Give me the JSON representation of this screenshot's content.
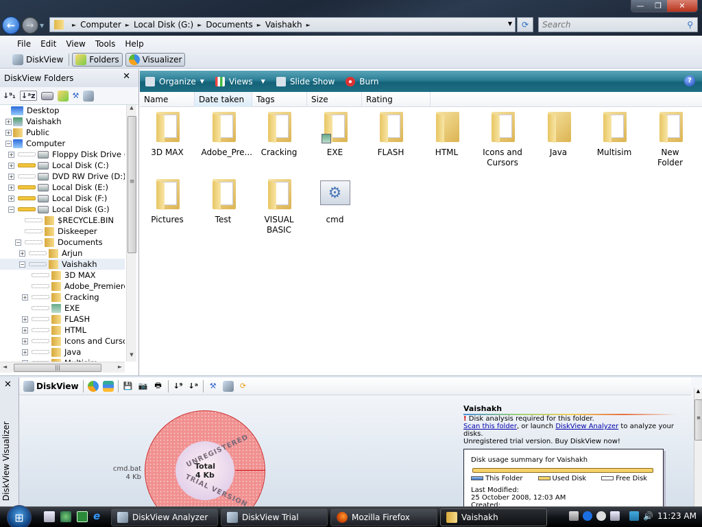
{
  "window": {
    "controls": {
      "minimize": "—",
      "restore": "❐",
      "close": "✕"
    }
  },
  "nav": {
    "back_icon": "←",
    "forward_icon": "→",
    "breadcrumbs": [
      "Computer",
      "Local Disk (G:)",
      "Documents",
      "Vaishakh"
    ],
    "refresh_icon": "⟳",
    "search_placeholder": "Search",
    "search_icon": "⚲"
  },
  "menu": {
    "items": [
      "File",
      "Edit",
      "View",
      "Tools",
      "Help"
    ]
  },
  "toolbar": {
    "diskview": "DiskView",
    "folders": "Folders",
    "visualizer": "Visualizer"
  },
  "sidebar": {
    "title": "DiskView Folders",
    "close": "✕",
    "tools": [
      "↓⁹₁",
      "↓ᵃz",
      "drive",
      "folder",
      "tools",
      "diskview"
    ],
    "tree": [
      {
        "label": "Desktop",
        "indent": 0,
        "toggle": "",
        "bar": "none",
        "icon": "desktop"
      },
      {
        "label": "Vaishakh",
        "indent": 1,
        "toggle": "+",
        "bar": "none",
        "icon": "user"
      },
      {
        "label": "Public",
        "indent": 1,
        "toggle": "+",
        "bar": "none",
        "icon": "folder"
      },
      {
        "label": "Computer",
        "indent": 1,
        "toggle": "−",
        "bar": "none",
        "icon": "computer"
      },
      {
        "label": "Floppy Disk Drive (A:)",
        "indent": 2,
        "toggle": "+",
        "bar": "empty",
        "icon": "drive"
      },
      {
        "label": "Local Disk (C:)",
        "indent": 2,
        "toggle": "+",
        "bar": "full",
        "icon": "drive"
      },
      {
        "label": "DVD RW Drive (D:)",
        "indent": 2,
        "toggle": "+",
        "bar": "empty",
        "icon": "drive"
      },
      {
        "label": "Local Disk (E:)",
        "indent": 2,
        "toggle": "+",
        "bar": "full",
        "icon": "drive"
      },
      {
        "label": "Local Disk (F:)",
        "indent": 2,
        "toggle": "+",
        "bar": "full",
        "icon": "drive"
      },
      {
        "label": "Local Disk (G:)",
        "indent": 2,
        "toggle": "−",
        "bar": "full",
        "icon": "drive"
      },
      {
        "label": "$RECYCLE.BIN",
        "indent": 3,
        "toggle": "",
        "bar": "empty",
        "icon": "folder"
      },
      {
        "label": "Diskeeper",
        "indent": 3,
        "toggle": "",
        "bar": "empty",
        "icon": "folder"
      },
      {
        "label": "Documents",
        "indent": 3,
        "toggle": "−",
        "bar": "empty",
        "icon": "folder"
      },
      {
        "label": "Arjun",
        "indent": 4,
        "toggle": "+",
        "bar": "empty",
        "icon": "folder"
      },
      {
        "label": "Vaishakh",
        "indent": 4,
        "toggle": "−",
        "bar": "empty",
        "icon": "folder",
        "selected": true
      },
      {
        "label": "3D MAX",
        "indent": 5,
        "toggle": "",
        "bar": "empty",
        "icon": "folder"
      },
      {
        "label": "Adobe_Premiere",
        "indent": 5,
        "toggle": "",
        "bar": "empty",
        "icon": "folder"
      },
      {
        "label": "Cracking",
        "indent": 5,
        "toggle": "+",
        "bar": "empty",
        "icon": "folder"
      },
      {
        "label": "EXE",
        "indent": 5,
        "toggle": "",
        "bar": "empty",
        "icon": "shortcut"
      },
      {
        "label": "FLASH",
        "indent": 5,
        "toggle": "+",
        "bar": "empty",
        "icon": "folder"
      },
      {
        "label": "HTML",
        "indent": 5,
        "toggle": "+",
        "bar": "empty",
        "icon": "folder"
      },
      {
        "label": "Icons and Cursors",
        "indent": 5,
        "toggle": "+",
        "bar": "empty",
        "icon": "folder"
      },
      {
        "label": "Java",
        "indent": 5,
        "toggle": "+",
        "bar": "empty",
        "icon": "folder"
      },
      {
        "label": "Multisim",
        "indent": 5,
        "toggle": "−",
        "bar": "empty",
        "icon": "folder"
      }
    ]
  },
  "commandbar": {
    "organize": "Organize",
    "views": "Views",
    "slideshow": "Slide Show",
    "burn": "Burn",
    "help": "?"
  },
  "columns": [
    "Name",
    "Date taken",
    "Tags",
    "Size",
    "Rating"
  ],
  "items": [
    {
      "label": "3D MAX",
      "type": "folder"
    },
    {
      "label": "Adobe_Pre...",
      "type": "folder"
    },
    {
      "label": "Cracking",
      "type": "folder"
    },
    {
      "label": "EXE",
      "type": "folder-shortcut"
    },
    {
      "label": "FLASH",
      "type": "folder"
    },
    {
      "label": "HTML",
      "type": "folder-empty"
    },
    {
      "label": "Icons and Cursors",
      "type": "folder"
    },
    {
      "label": "Java",
      "type": "folder-empty"
    },
    {
      "label": "Multisim",
      "type": "folder"
    },
    {
      "label": "New Folder",
      "type": "folder"
    },
    {
      "label": "Pictures",
      "type": "folder"
    },
    {
      "label": "Test",
      "type": "folder"
    },
    {
      "label": "VISUAL BASIC",
      "type": "folder"
    },
    {
      "label": "cmd",
      "type": "batch"
    }
  ],
  "visualizer": {
    "side_label": "DiskView Visualizer",
    "close": "✕",
    "toolbar_label": "DiskView",
    "chart": {
      "center_title": "Total",
      "center_value": "4 Kb",
      "watermark_top": "UNREGISTERED",
      "watermark_bottom": "TRIAL VERSION",
      "segment_label": "cmd.bat",
      "segment_value": "4 Kb",
      "segment_fraction": 1.0
    },
    "info": {
      "title": "Vaishakh",
      "warn_mark": "!",
      "warning": " Disk analysis required for this folder.",
      "scan_link": "Scan this folder",
      "mid_text": ", or launch ",
      "analyzer_link": "DiskView Analyzer",
      "end_text": " to analyze your disks.",
      "trial": "Unregistered trial version. Buy DiskView now!"
    },
    "summary": {
      "title": "Disk usage summary for Vaishakh",
      "legend": [
        "This Folder",
        "Used Disk",
        "Free Disk"
      ],
      "last_modified_label": "Last Modified:",
      "last_modified": "25 October 2008, 12:03 AM",
      "created_label": "Created:"
    }
  },
  "taskbar": {
    "start": "⊞",
    "tasks": [
      {
        "label": "DiskView Analyzer",
        "active": false
      },
      {
        "label": "DiskView Trial",
        "active": false
      },
      {
        "label": "Mozilla Firefox",
        "active": false
      },
      {
        "label": "Vaishakh",
        "active": true
      }
    ],
    "clock": "11:23 AM"
  },
  "colors": {
    "accent": "#1f6f85",
    "folder": "#f0cf70",
    "chart_ring": "#f19090",
    "used_disk": "#f6d36a"
  }
}
